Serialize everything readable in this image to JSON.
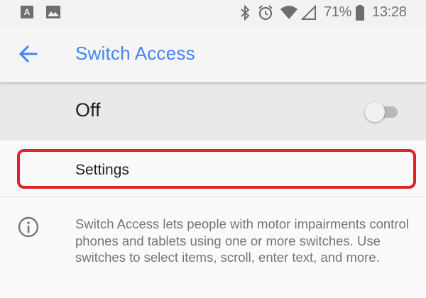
{
  "status_bar": {
    "left_icons": [
      "font-notification-icon",
      "image-notification-icon"
    ],
    "right_icons": [
      "bluetooth-icon",
      "alarm-icon",
      "wifi-icon",
      "cell-signal-icon",
      "battery-icon"
    ],
    "battery_percent": "71%",
    "time": "13:28"
  },
  "app_bar": {
    "back_icon": "arrow-back-icon",
    "title": "Switch Access"
  },
  "master_switch": {
    "label": "Off",
    "enabled": false
  },
  "settings_item": {
    "label": "Settings",
    "highlight_color": "#e0202c"
  },
  "description": {
    "icon": "info-icon",
    "text": "Switch Access lets people with motor impairments control phones and tablets using one or more switches. Use switches to select items, scroll, enter text, and more."
  },
  "colors": {
    "accent": "#4285f4",
    "switch_row_bg": "#e9e9e9",
    "app_bar_bg": "#f5f5f5"
  }
}
